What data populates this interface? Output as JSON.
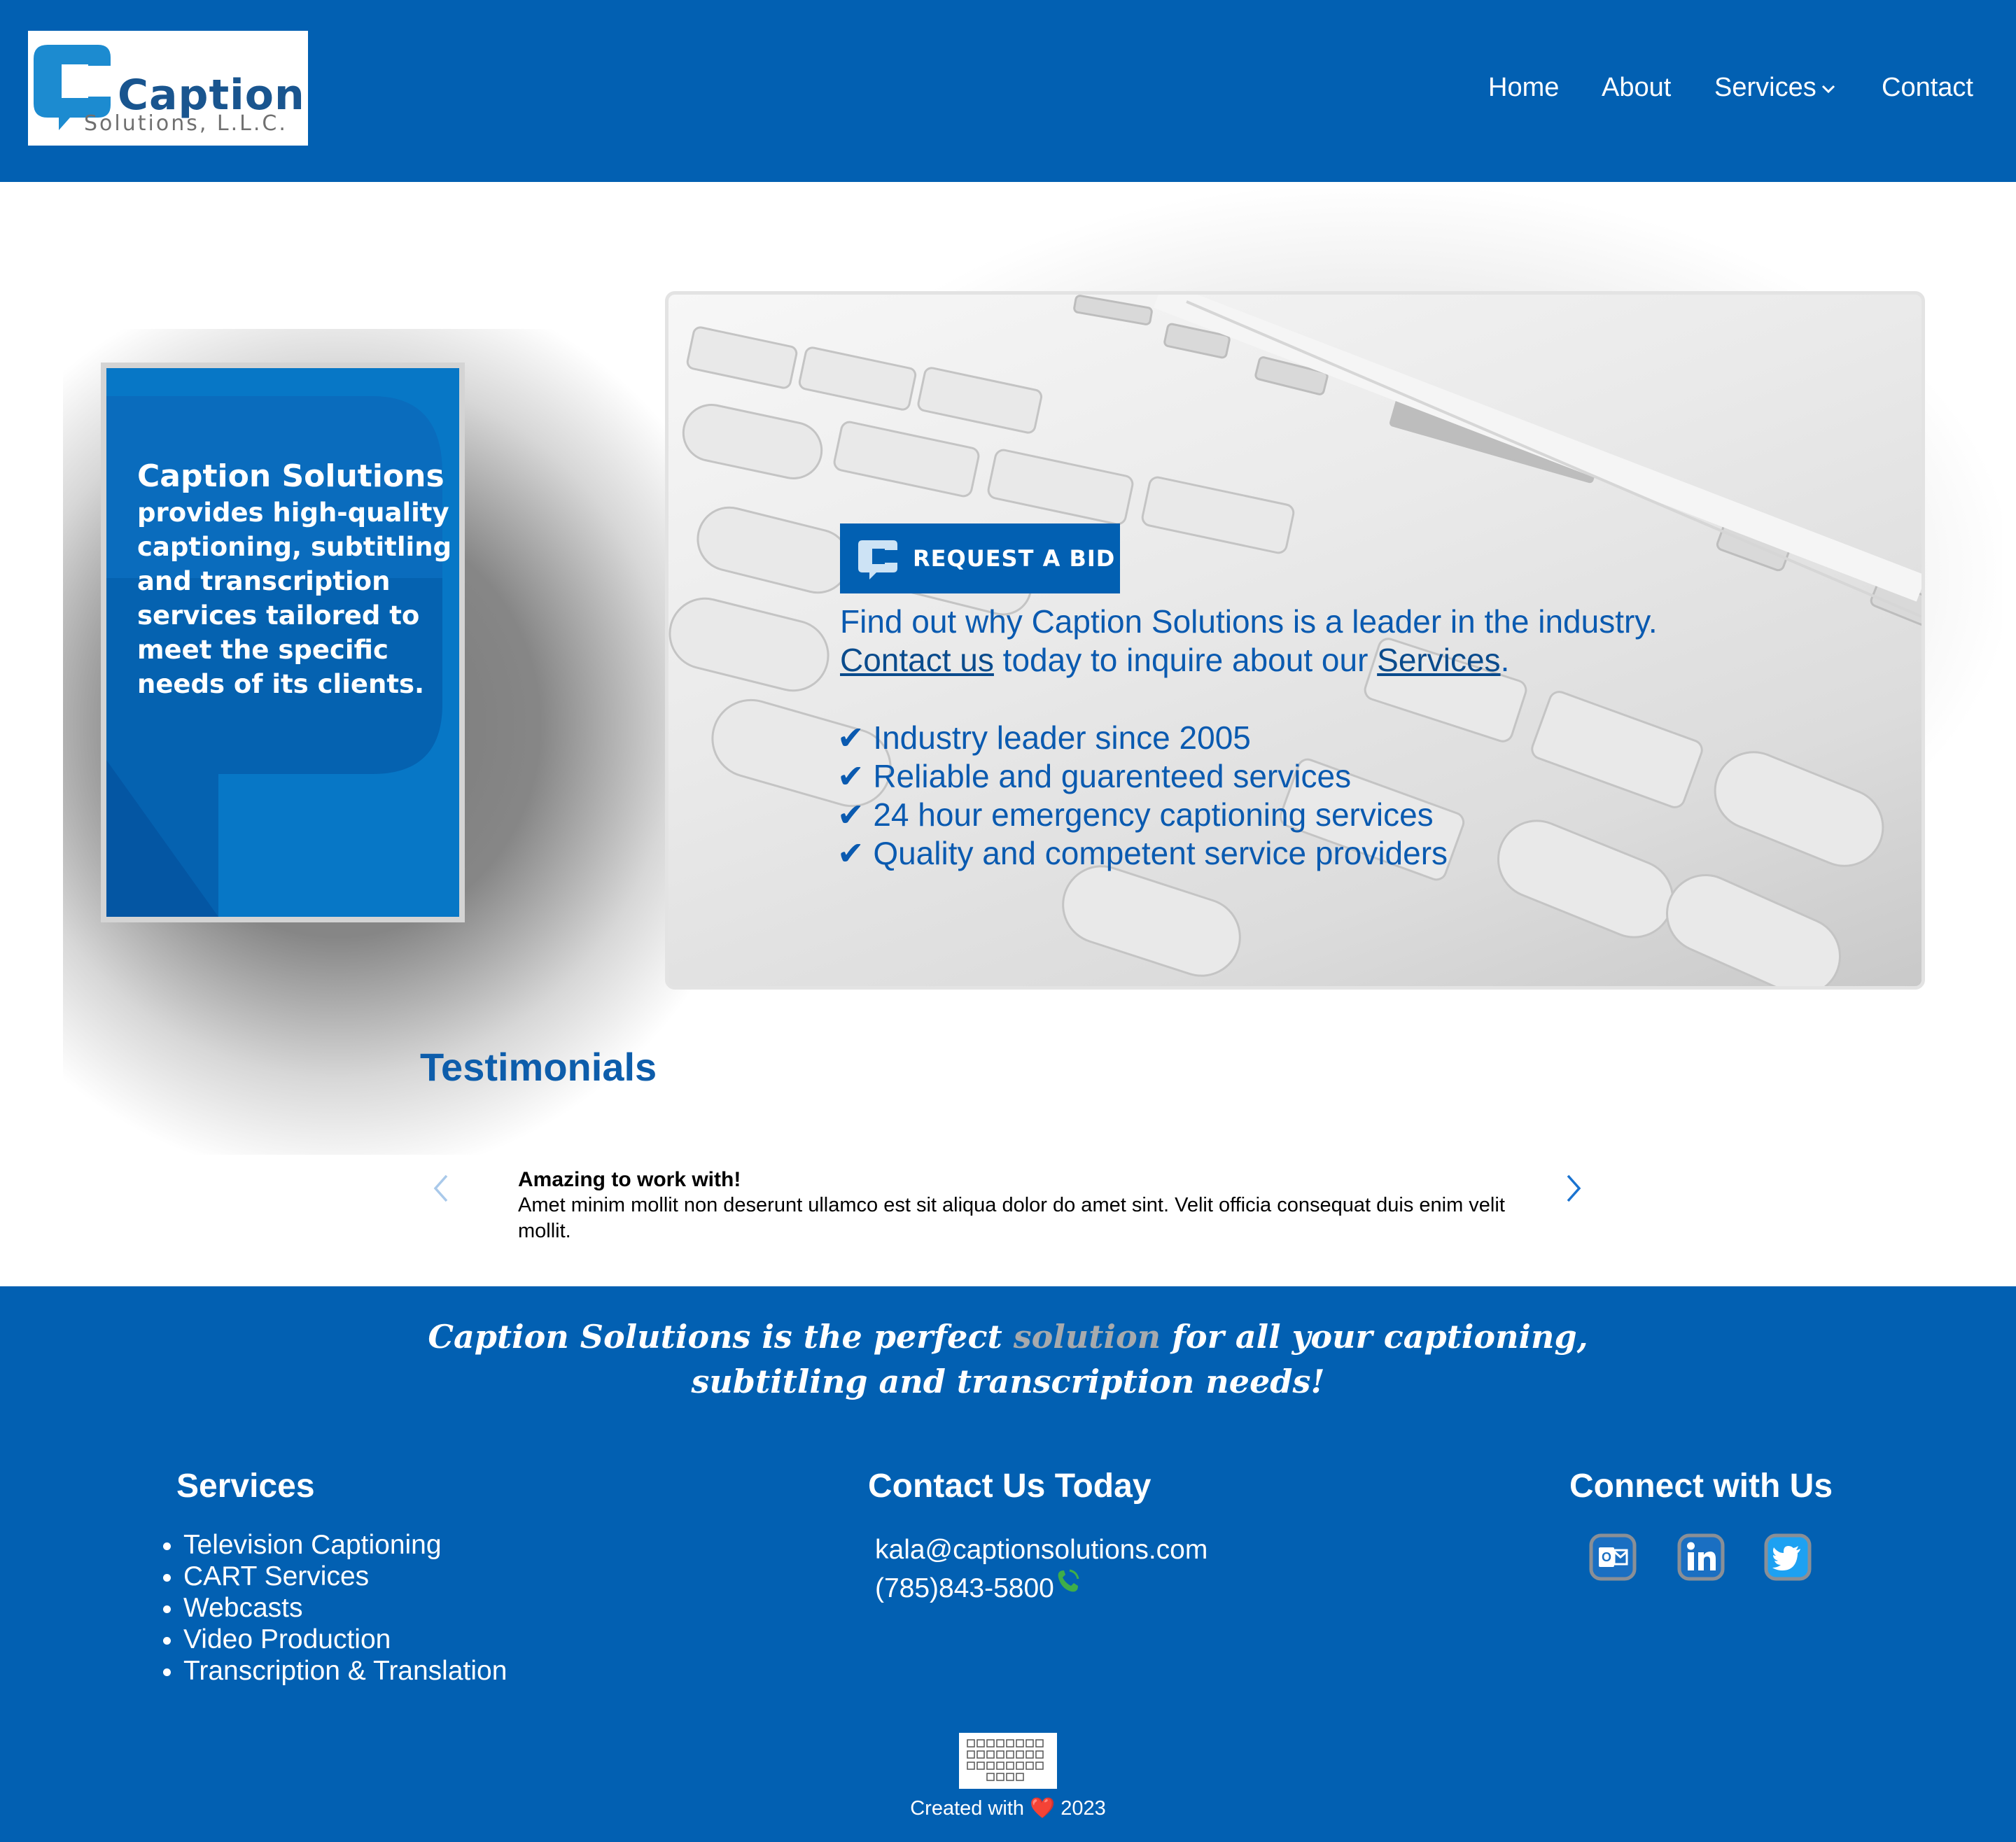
{
  "brand": {
    "name": "Caption",
    "subname": "Solutions, L.L.C."
  },
  "nav": {
    "home": "Home",
    "about": "About",
    "services": "Services",
    "contact": "Contact"
  },
  "poster": {
    "lead": "Caption Solutions",
    "text": "provides high-quality captioning, subtitling and transcription services tailored to meet the specific needs of its clients."
  },
  "hero": {
    "cta_label": "REQUEST A BID",
    "line1": "Find out why Caption Solutions is a leader in the industry.",
    "contact_link": "Contact us",
    "line2_mid": " today to inquire about our ",
    "services_link": "Services",
    "line2_end": ".",
    "checks": [
      "✔ Industry leader since 2005",
      "✔ Reliable and guarenteed services",
      "✔ 24 hour emergency captioning services",
      "✔ Quality and competent service providers"
    ]
  },
  "testimonials": {
    "title": "Testimonials",
    "headline": "Amazing to work with!",
    "body": "Amet minim mollit non deserunt ullamco est sit aliqua dolor do amet sint. Velit officia consequat duis enim velit mollit."
  },
  "footer": {
    "tagline_pre": "Caption Solutions is the perfect ",
    "tagline_hl": "solution",
    "tagline_post": " for all your captioning,",
    "tagline_line2": "subtitling and transcription needs!",
    "services_title": "Services",
    "services": [
      "Television Captioning",
      "CART Services",
      "Webcasts",
      "Video Production",
      "Transcription & Translation"
    ],
    "contact_title": "Contact Us Today",
    "email": "kala@captionsolutions.com",
    "phone": "(785)843-5800",
    "connect_title": "Connect with Us",
    "social_icons": [
      "outlook-icon",
      "linkedin-icon",
      "twitter-icon"
    ],
    "credit_pre": "Created with ",
    "credit_heart": "❤️",
    "credit_year": " 2023"
  },
  "colors": {
    "brand_blue": "#0260b2",
    "text_blue": "#0a5ab0",
    "poster_blue": "#0777c6"
  }
}
